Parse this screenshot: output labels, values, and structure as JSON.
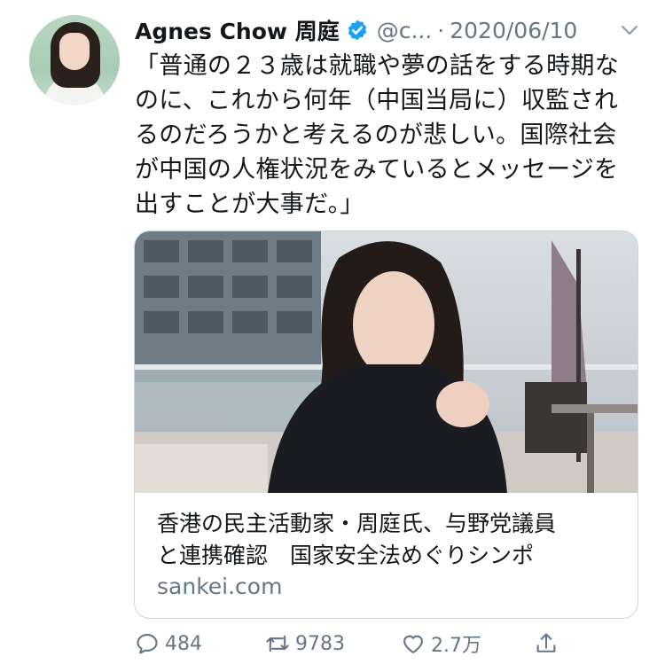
{
  "tweet": {
    "author_name": "Agnes Chow 周庭",
    "handle": "@c...",
    "separator": "·",
    "date": "2020/06/10",
    "text_lines": [
      "「普通の２３歳は就職や夢の話をする時期な",
      "のに、これから何年（中国当局に）収監され",
      "るのだろうかと考えるのが悲しい。国際社会",
      "が中国の人権状況をみているとメッセージを",
      "出すことが大事だ。」"
    ]
  },
  "card": {
    "title_lines": [
      "香港の民主活動家・周庭氏、与野党議員",
      "と連携確認　国家安全法めぐりシンポ"
    ],
    "domain": "sankei.com"
  },
  "actions": {
    "reply_count": "484",
    "retweet_count": "9783",
    "like_count": "2.7万"
  },
  "icons": {
    "verified": "verified-badge-icon",
    "more": "chevron-down-icon",
    "reply": "reply-icon",
    "retweet": "retweet-icon",
    "like": "heart-icon",
    "share": "share-icon"
  },
  "colors": {
    "text": "#14171a",
    "secondary": "#657786",
    "verified": "#1da1f2",
    "border": "#ccd6dd"
  }
}
